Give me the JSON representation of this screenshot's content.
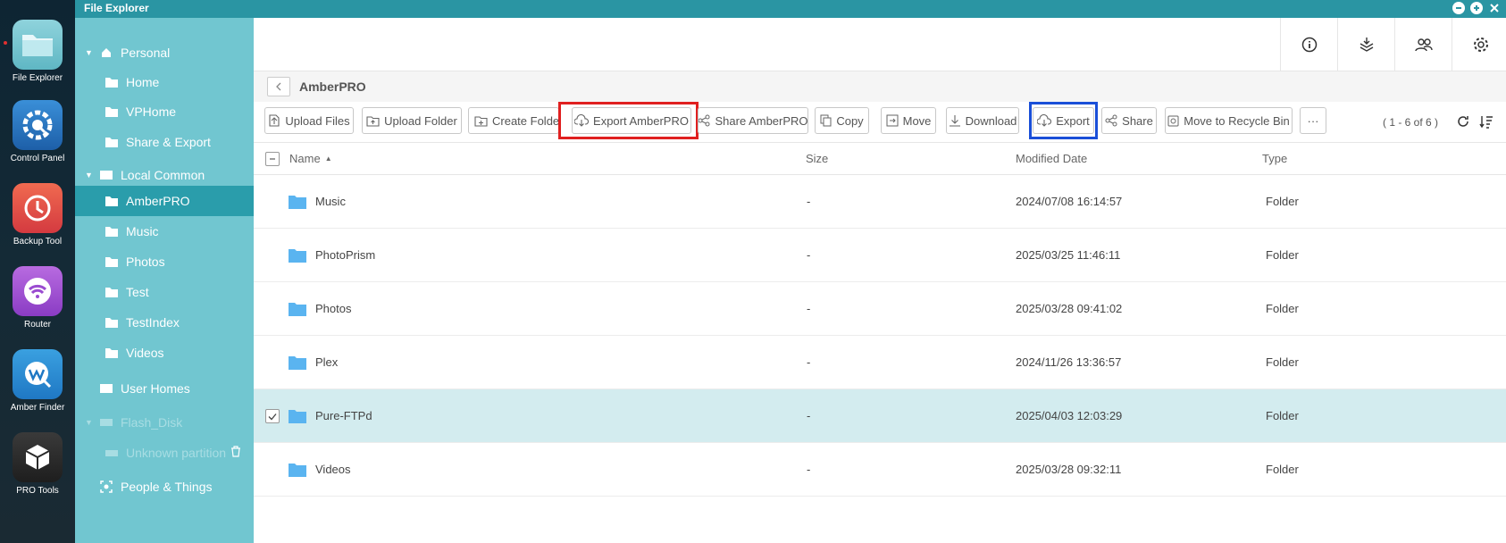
{
  "dock": {
    "apps": [
      {
        "label": "File Explorer",
        "icon": "folder-app-icon"
      },
      {
        "label": "Control Panel",
        "icon": "gear-app-icon"
      },
      {
        "label": "Backup Tool",
        "icon": "clock-app-icon"
      },
      {
        "label": "Router",
        "icon": "wifi-app-icon"
      },
      {
        "label": "Amber Finder",
        "icon": "finder-app-icon"
      },
      {
        "label": "PRO Tools",
        "icon": "cube-app-icon"
      }
    ]
  },
  "window": {
    "title": "File Explorer"
  },
  "sidebar": {
    "personal": "Personal",
    "home": "Home",
    "vphome": "VPHome",
    "share_export": "Share & Export",
    "local_common": "Local Common",
    "amberpro": "AmberPRO",
    "music": "Music",
    "photos": "Photos",
    "test": "Test",
    "testindex": "TestIndex",
    "videos": "Videos",
    "user_homes": "User Homes",
    "flash_disk": "Flash_Disk",
    "unknown_partition": "Unknown partition",
    "people_things": "People & Things"
  },
  "breadcrumb": {
    "current": "AmberPRO"
  },
  "toolbar": {
    "upload_files": "Upload Files",
    "upload_folder": "Upload Folder",
    "create_folder": "Create Folder",
    "export_amberpro": "Export AmberPRO",
    "share_amberpro": "Share AmberPRO",
    "copy": "Copy",
    "move": "Move",
    "download": "Download",
    "export": "Export",
    "share": "Share",
    "recycle": "Move to Recycle Bin",
    "more": "···",
    "count": "( 1 - 6 of 6 )"
  },
  "table": {
    "headers": {
      "name": "Name",
      "size": "Size",
      "modified": "Modified Date",
      "type": "Type"
    },
    "rows": [
      {
        "name": "Music",
        "size": "-",
        "modified": "2024/07/08 16:14:57",
        "type": "Folder"
      },
      {
        "name": "PhotoPrism",
        "size": "-",
        "modified": "2025/03/25 11:46:11",
        "type": "Folder"
      },
      {
        "name": "Photos",
        "size": "-",
        "modified": "2025/03/28 09:41:02",
        "type": "Folder"
      },
      {
        "name": "Plex",
        "size": "-",
        "modified": "2024/11/26 13:36:57",
        "type": "Folder"
      },
      {
        "name": "Pure-FTPd",
        "size": "-",
        "modified": "2025/04/03 12:03:29",
        "type": "Folder"
      },
      {
        "name": "Videos",
        "size": "-",
        "modified": "2025/03/28 09:32:11",
        "type": "Folder"
      }
    ]
  },
  "colors": {
    "titlebar": "#2a95a3",
    "sidebar": "#71c6d0",
    "sidebar_active": "#2a9dab",
    "selected_row": "#d3ecef",
    "folder": "#5ab4f0",
    "highlight_red": "#e02020",
    "highlight_blue": "#1a4fd8"
  }
}
